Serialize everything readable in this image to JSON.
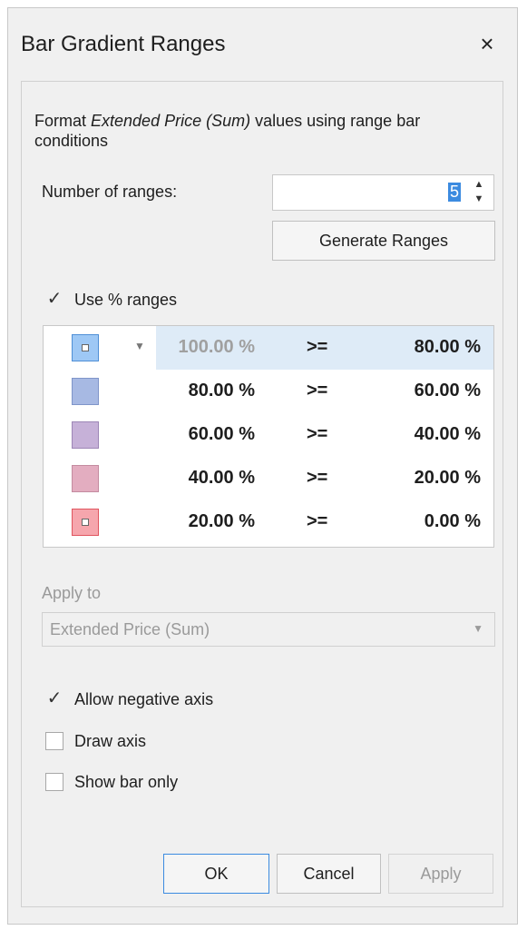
{
  "dialog": {
    "title": "Bar Gradient Ranges",
    "close_glyph": "×",
    "desc_prefix": "Format ",
    "desc_field": "Extended Price (Sum)",
    "desc_suffix": " values using range bar conditions",
    "num_ranges_label": "Number of ranges:",
    "num_ranges_value": "5",
    "generate_label": "Generate Ranges",
    "use_percent_label": "Use % ranges",
    "use_percent_checked": true,
    "ranges": [
      {
        "from": "100.00 %",
        "op": ">=",
        "to": "80.00 %",
        "color": "#9ec8f5",
        "border": "#4f8fd6",
        "inner": true,
        "selected": true
      },
      {
        "from": "80.00 %",
        "op": ">=",
        "to": "60.00 %",
        "color": "#a7b9e3",
        "border": "#7f95c9",
        "inner": false,
        "selected": false
      },
      {
        "from": "60.00 %",
        "op": ">=",
        "to": "40.00 %",
        "color": "#c6b1d8",
        "border": "#9d86b6",
        "inner": false,
        "selected": false
      },
      {
        "from": "40.00 %",
        "op": ">=",
        "to": "20.00 %",
        "color": "#e3adc0",
        "border": "#c48ba0",
        "inner": false,
        "selected": false
      },
      {
        "from": "20.00 %",
        "op": ">=",
        "to": "0.00 %",
        "color": "#f6a6ad",
        "border": "#e0555f",
        "inner": true,
        "selected": false
      }
    ],
    "apply_to_label": "Apply to",
    "apply_to_value": "Extended Price (Sum)",
    "options": [
      {
        "label": "Allow negative axis",
        "checked": true
      },
      {
        "label": "Draw axis",
        "checked": false
      },
      {
        "label": "Show bar only",
        "checked": false
      }
    ],
    "ok_label": "OK",
    "cancel_label": "Cancel",
    "apply_label": "Apply"
  }
}
